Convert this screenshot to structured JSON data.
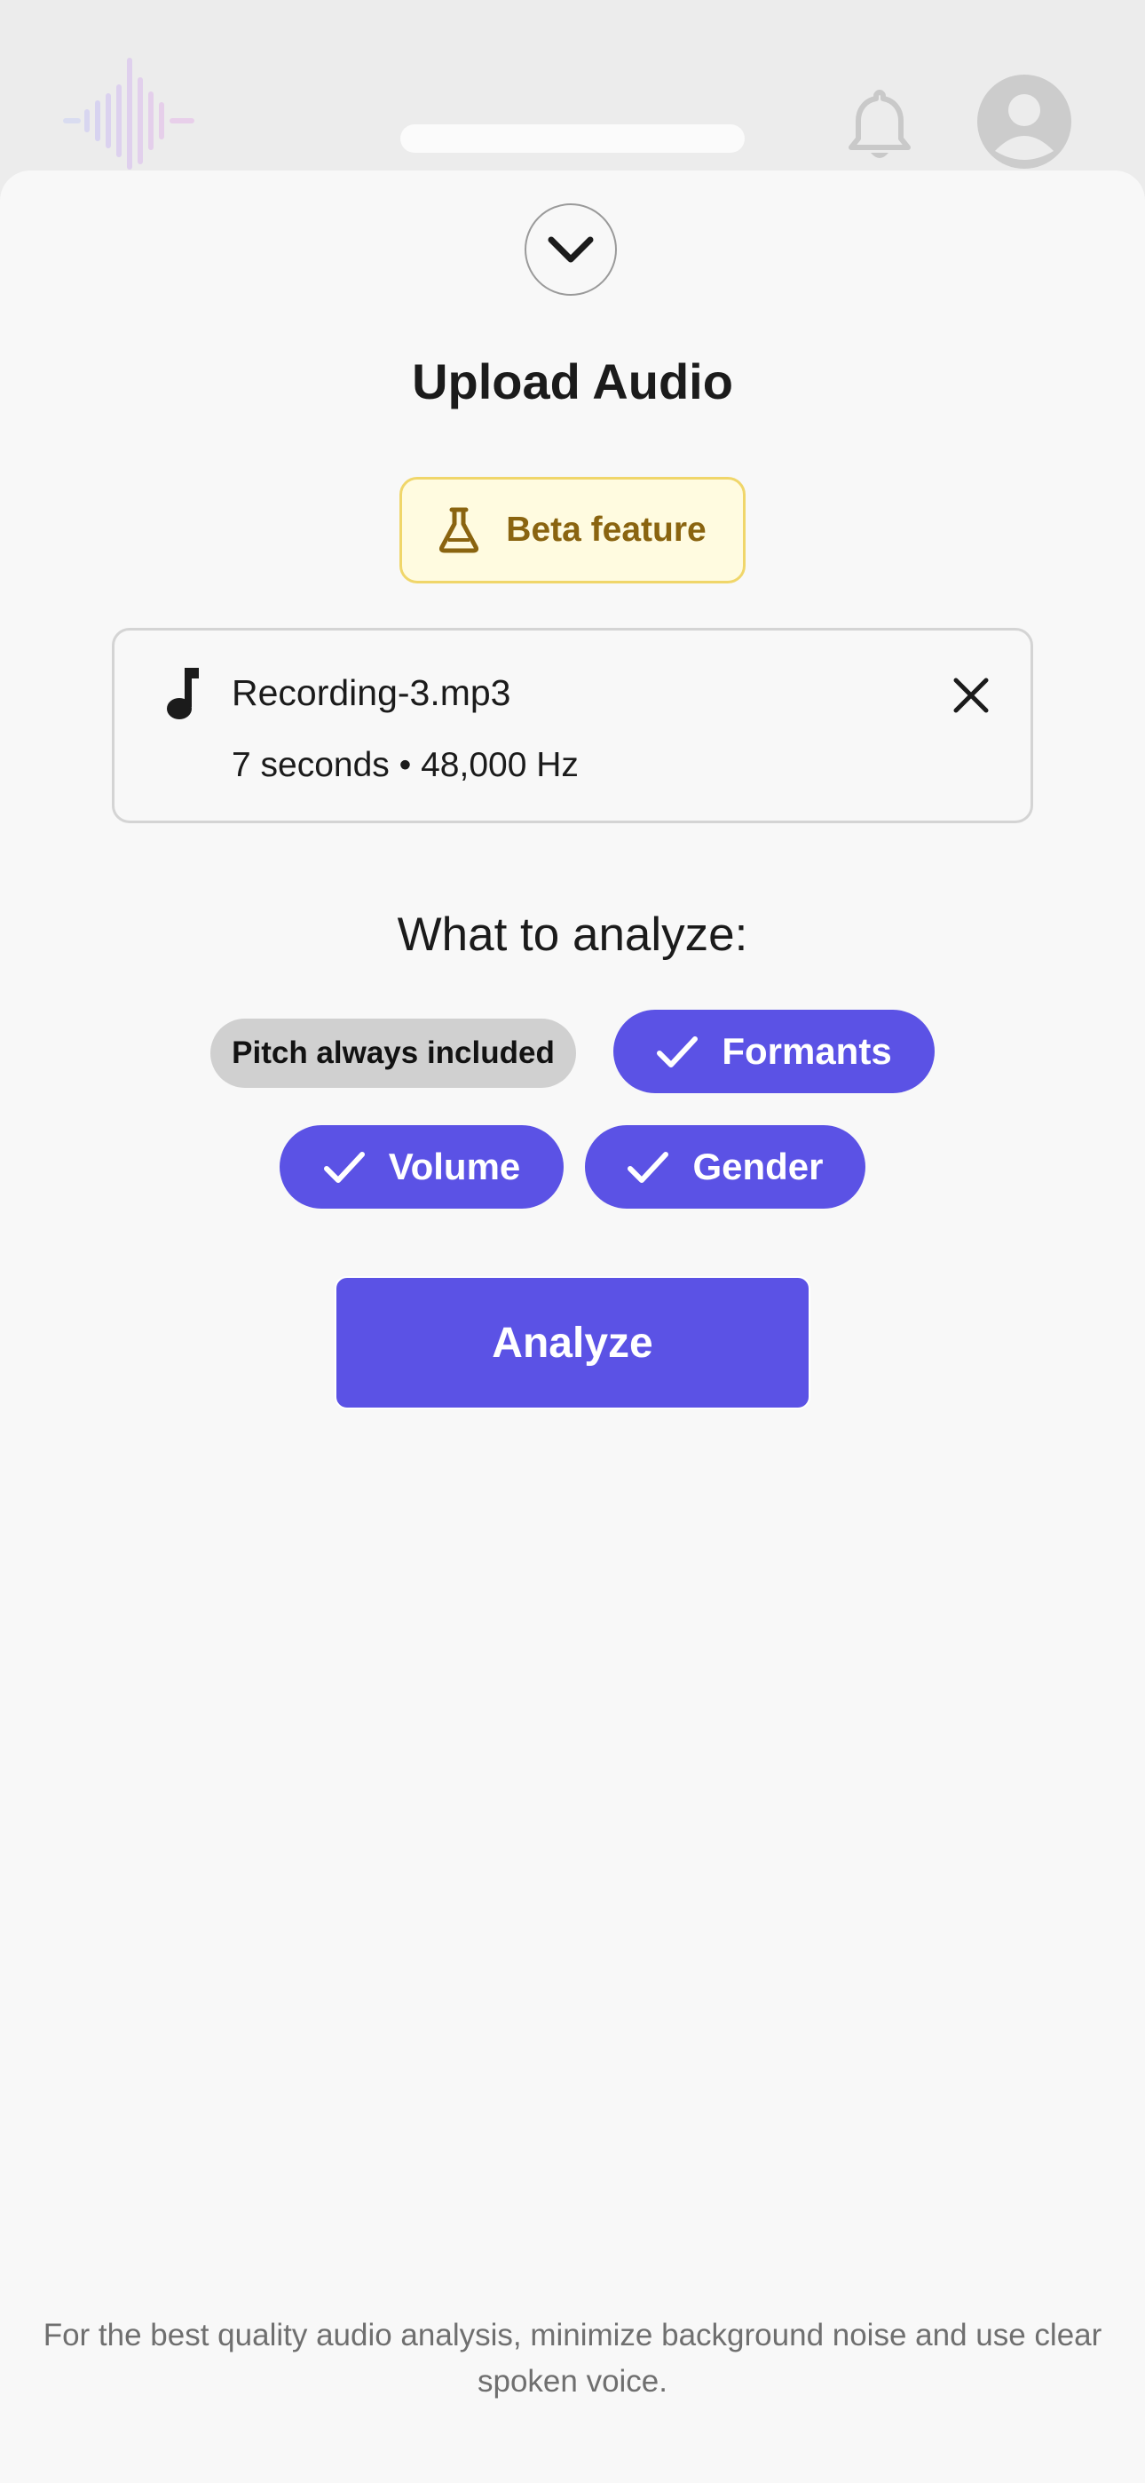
{
  "sheet": {
    "title": "Upload Audio",
    "beta_badge": {
      "label": "Beta feature",
      "icon": "flask-icon"
    },
    "file": {
      "name": "Recording-3.mp3",
      "meta": "7 seconds • 48,000 Hz",
      "icon": "music-note-icon"
    },
    "analyze_heading": "What to analyze:",
    "options": {
      "pitch": {
        "label": "Pitch always included"
      },
      "formants": {
        "label": "Formants",
        "checked": true
      },
      "volume": {
        "label": "Volume",
        "checked": true
      },
      "gender": {
        "label": "Gender",
        "checked": true
      }
    },
    "analyze_button": "Analyze",
    "footer_tip": "For the best quality audio analysis, minimize background noise and use clear spoken voice."
  },
  "colors": {
    "accent": "#5b52e5",
    "beta_bg": "#fffbe0",
    "beta_border": "#f0d66a",
    "beta_text": "#8a6410"
  }
}
